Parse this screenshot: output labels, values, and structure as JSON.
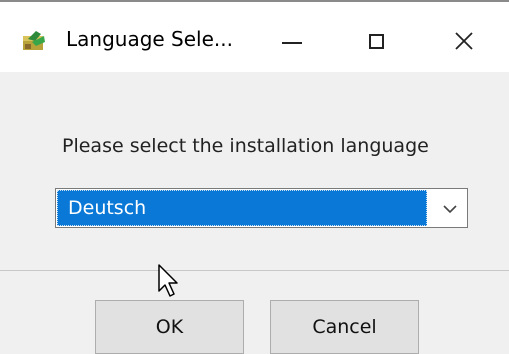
{
  "window": {
    "title": "Language Sele...",
    "controls": {
      "minimize": "minimize-icon",
      "maximize": "maximize-icon",
      "close": "close-icon"
    }
  },
  "dialog": {
    "prompt": "Please select the installation language",
    "language_select": {
      "selected": "Deutsch"
    },
    "buttons": {
      "ok": "OK",
      "cancel": "Cancel"
    }
  },
  "colors": {
    "selection": "#0a78d7",
    "background": "#f0f0f0",
    "titlebar": "#ffffff"
  }
}
